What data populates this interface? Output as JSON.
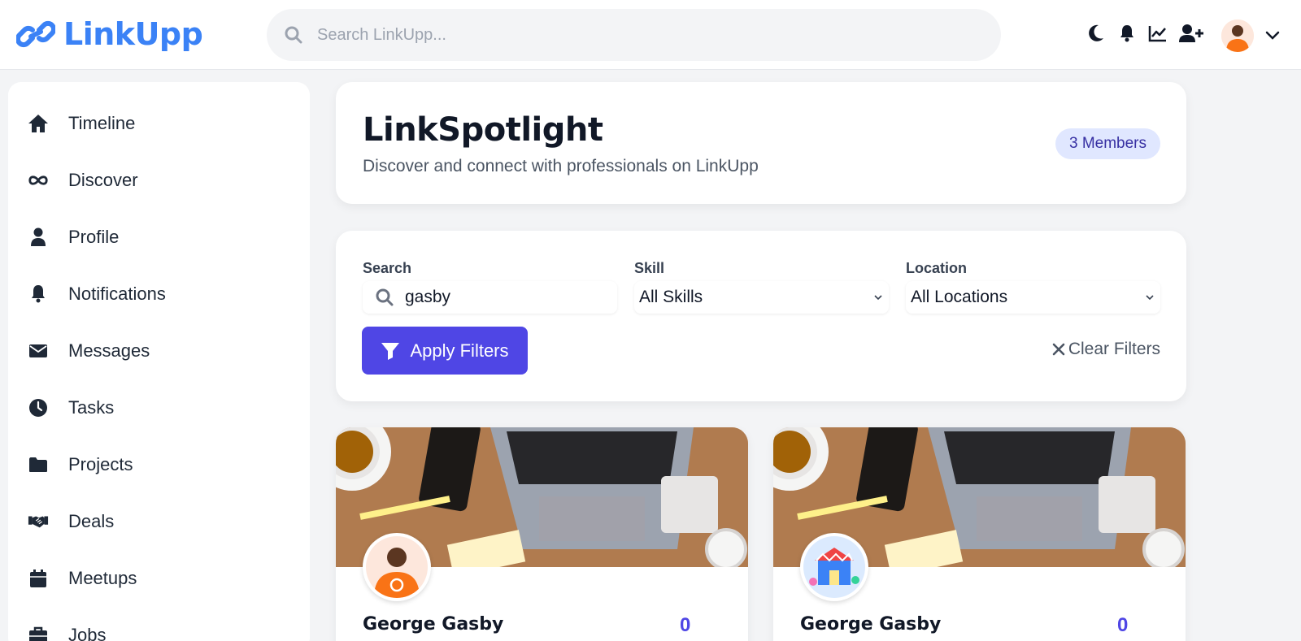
{
  "header": {
    "brand": "LinkUpp",
    "search_placeholder": "Search LinkUpp...",
    "icons": [
      "moon-icon",
      "bell-icon",
      "chart-line-icon",
      "user-plus-icon",
      "chevron-down-icon"
    ]
  },
  "sidebar": {
    "items": [
      {
        "label": "Timeline",
        "icon": "home-icon"
      },
      {
        "label": "Discover",
        "icon": "infinity-icon"
      },
      {
        "label": "Profile",
        "icon": "user-icon"
      },
      {
        "label": "Notifications",
        "icon": "bell-icon"
      },
      {
        "label": "Messages",
        "icon": "envelope-icon"
      },
      {
        "label": "Tasks",
        "icon": "clock-icon"
      },
      {
        "label": "Projects",
        "icon": "folder-icon"
      },
      {
        "label": "Deals",
        "icon": "handshake-icon"
      },
      {
        "label": "Meetups",
        "icon": "calendar-icon"
      },
      {
        "label": "Jobs",
        "icon": "briefcase-icon"
      }
    ]
  },
  "spotlight": {
    "title": "LinkSpotlight",
    "subtitle": "Discover and connect with professionals on LinkUpp",
    "badge": "3 Members"
  },
  "filters": {
    "search_label": "Search",
    "search_value": "gasby",
    "skill_label": "Skill",
    "skill_value": "All Skills",
    "location_label": "Location",
    "location_value": "All Locations",
    "apply_label": "Apply Filters",
    "clear_label": "Clear Filters"
  },
  "members": [
    {
      "name": "George Gasby",
      "count": "0"
    },
    {
      "name": "George Gasby",
      "count": "0"
    }
  ],
  "colors": {
    "brand": "#3b82f6",
    "accent": "#4f46e5",
    "badge_bg": "#e0e7ff",
    "badge_text": "#3730a3"
  }
}
